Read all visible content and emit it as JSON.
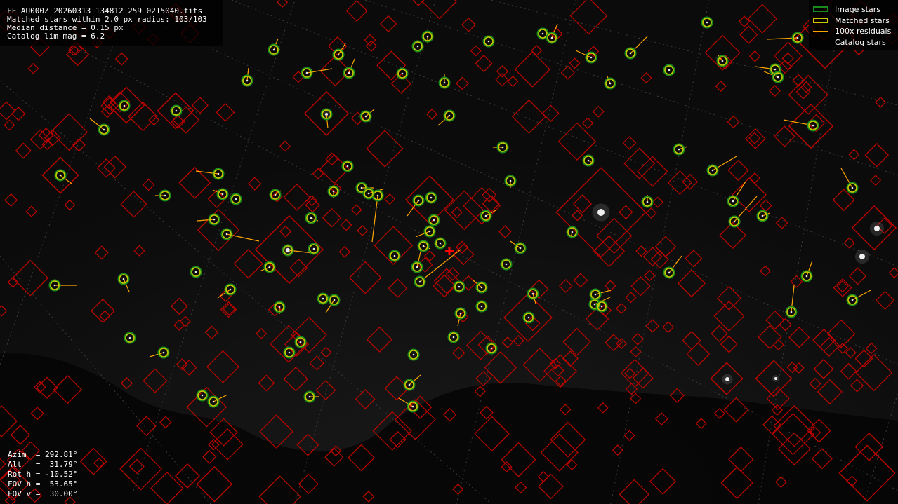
{
  "info": {
    "filename": "FF_AU000Z_20260313_134812_259_0215040.fits",
    "matched_stars": "Matched stars within 2.0 px radius: 103/103",
    "median_distance": "Median distance = 0.15 px",
    "catalog_lim_mag": "Catalog lim mag = 6.2"
  },
  "legend": {
    "image_stars": {
      "label": "Image stars",
      "color": "#1a8a1a"
    },
    "matched_stars": {
      "label": "Matched stars",
      "color": "#c8c800"
    },
    "residuals": {
      "label": "100x residuals",
      "color": "#ffa500"
    },
    "catalog_stars": {
      "label": "Catalog stars",
      "color": "#cc0000"
    }
  },
  "pointing": {
    "azim": "Azim  = 292.81°",
    "alt": "Alt   =  31.79°",
    "rot": "Rot h = -10.52°",
    "fov_h": "FOV h =  53.65°",
    "fov_v": "FOV v =  30.00°"
  },
  "colors": {
    "background": "#0b0b0b",
    "catalog": "#c00000",
    "matched_ring": "#c8c800",
    "matched_fill": "#1a8a1a",
    "residual": "#ffa500",
    "center_cross": "#ff0000"
  }
}
